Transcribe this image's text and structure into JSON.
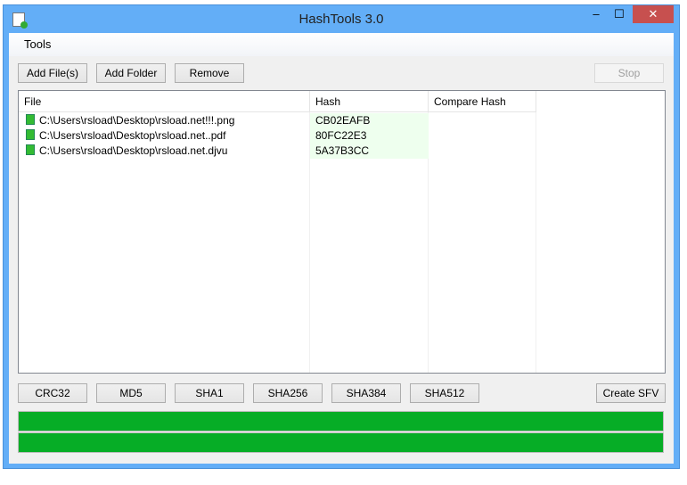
{
  "window": {
    "title": "HashTools 3.0",
    "minimize": "‒",
    "maximize": "☐",
    "close": "✕"
  },
  "menu": {
    "tools": "Tools"
  },
  "toolbar": {
    "add_files": "Add File(s)",
    "add_folder": "Add Folder",
    "remove": "Remove",
    "stop": "Stop"
  },
  "list": {
    "columns": [
      "File",
      "Hash",
      "Compare Hash"
    ],
    "rows": [
      {
        "file": "C:\\Users\\rsload\\Desktop\\rsload.net!!!.png",
        "hash": "CB02EAFB",
        "compare": ""
      },
      {
        "file": "C:\\Users\\rsload\\Desktop\\rsload.net..pdf",
        "hash": "80FC22E3",
        "compare": ""
      },
      {
        "file": "C:\\Users\\rsload\\Desktop\\rsload.net.djvu",
        "hash": "5A37B3CC",
        "compare": ""
      }
    ]
  },
  "algorithms": [
    "CRC32",
    "MD5",
    "SHA1",
    "SHA256",
    "SHA384",
    "SHA512"
  ],
  "create_sfv": "Create SFV",
  "progress": {
    "file": 100,
    "total": 100
  },
  "colors": {
    "titlebar": "#63aef7",
    "progress": "#06ad26",
    "close": "#c7504f"
  }
}
